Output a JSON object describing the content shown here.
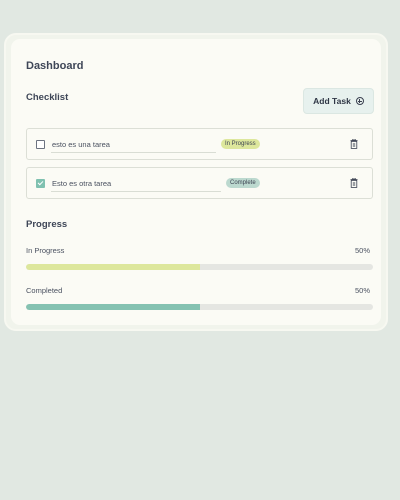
{
  "dashboard": {
    "title": "Dashboard"
  },
  "checklist": {
    "title": "Checklist",
    "add_button_label": "Add Task",
    "add_icon": "circle-plus-icon",
    "tasks": [
      {
        "text": "esto es una tarea",
        "checked": false,
        "status": "In Progress",
        "status_color": "#dde79c"
      },
      {
        "text": "Esto es otra tarea",
        "checked": true,
        "status": "Complete",
        "status_color": "#bcd9cf"
      }
    ],
    "delete_icon": "trash-icon"
  },
  "progress": {
    "title": "Progress",
    "items": [
      {
        "label": "In Progress",
        "value": "50%",
        "fraction": 0.5,
        "color": "#dde79c"
      },
      {
        "label": "Completed",
        "value": "50%",
        "fraction": 0.5,
        "color": "#85c2b1"
      }
    ]
  },
  "colors": {
    "background": "#e1e8e2",
    "card": "#fbfbf5",
    "accent_button": "#e7f1ee",
    "in_progress": "#dde79c",
    "complete": "#85c2b1"
  }
}
